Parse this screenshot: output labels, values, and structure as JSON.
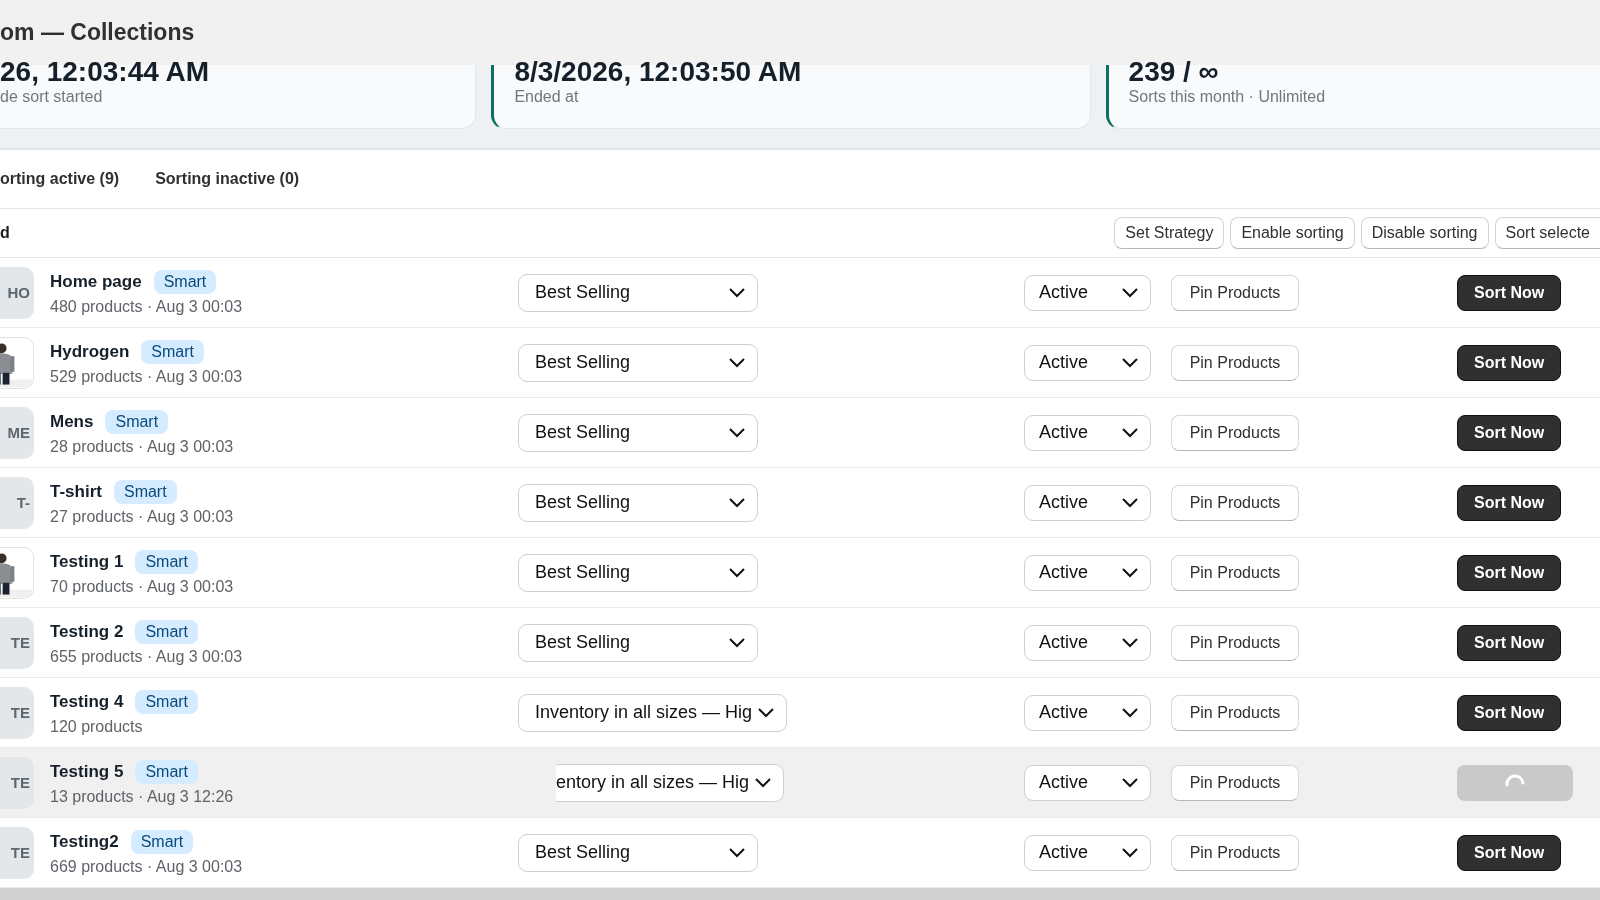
{
  "header": {
    "title": "om — Collections"
  },
  "stats": [
    {
      "value": "26, 12:03:44 AM",
      "label": "de sort started",
      "accent": false
    },
    {
      "value": "8/3/2026, 12:03:50 AM",
      "label": "Ended at",
      "accent": true
    },
    {
      "value": "239 / ∞",
      "label": "Sorts this month · Unlimited",
      "accent": true
    }
  ],
  "tabs": [
    {
      "label": "orting active (9)"
    },
    {
      "label": "Sorting inactive (0)"
    }
  ],
  "toolbar": {
    "label": "d",
    "buttons": [
      "Set Strategy",
      "Enable sorting",
      "Disable sorting",
      "Sort selecte"
    ]
  },
  "rows": [
    {
      "thumb": {
        "kind": "initials",
        "text": "HO"
      },
      "name": "Home page",
      "tag": "Smart",
      "meta": "480 products · Aug 3 00:03",
      "strategy": "Best Selling",
      "status": "Active",
      "pin": "Pin Products",
      "sort": {
        "kind": "button",
        "label": "Sort Now"
      }
    },
    {
      "name": "Hydrogen",
      "tag": "Smart",
      "meta": "529 products · Aug 3 00:03",
      "strategy": "Best Selling",
      "status": "Active",
      "pin": "Pin Products",
      "sort": {
        "kind": "button",
        "label": "Sort Now"
      }
    },
    {
      "thumb": {
        "kind": "initials",
        "text": "ME"
      },
      "name": "Mens",
      "tag": "Smart",
      "meta": "28 products · Aug 3 00:03",
      "strategy": "Best Selling",
      "status": "Active",
      "pin": "Pin Products",
      "sort": {
        "kind": "button",
        "label": "Sort Now"
      }
    },
    {
      "thumb": {
        "kind": "initials",
        "text": "T-"
      },
      "name": "T-shirt",
      "tag": "Smart",
      "meta": "27 products · Aug 3 00:03",
      "strategy": "Best Selling",
      "status": "Active",
      "pin": "Pin Products",
      "sort": {
        "kind": "button",
        "label": "Sort Now"
      }
    },
    {
      "name": "Testing 1",
      "tag": "Smart",
      "meta": "70 products · Aug 3 00:03",
      "strategy": "Best Selling",
      "status": "Active",
      "pin": "Pin Products",
      "sort": {
        "kind": "button",
        "label": "Sort Now"
      }
    },
    {
      "thumb": {
        "kind": "initials",
        "text": "TE"
      },
      "name": "Testing 2",
      "tag": "Smart",
      "meta": "655 products · Aug 3 00:03",
      "strategy": "Best Selling",
      "status": "Active",
      "pin": "Pin Products",
      "sort": {
        "kind": "button",
        "label": "Sort Now"
      }
    },
    {
      "thumb": {
        "kind": "initials",
        "text": "TE"
      },
      "name": "Testing 4",
      "tag": "Smart",
      "meta": "120 products",
      "strategy": "Inventory in all sizes — Hig",
      "status": "Active",
      "pin": "Pin Products",
      "sort": {
        "kind": "button",
        "label": "Sort Now"
      }
    },
    {
      "thumb": {
        "kind": "initials",
        "text": "TE"
      },
      "name": "Testing 5",
      "tag": "Smart",
      "meta": "13 products · Aug 3 12:26",
      "strategy": "entory in all sizes — Hig",
      "status": "Active",
      "pin": "Pin Products",
      "sort": {
        "kind": "loading"
      }
    },
    {
      "thumb": {
        "kind": "initials",
        "text": "TE"
      },
      "name": "Testing2",
      "tag": "Smart",
      "meta": "669 products · Aug 3 00:03",
      "strategy": "Best Selling",
      "status": "Active",
      "pin": "Pin Products",
      "sort": {
        "kind": "button",
        "label": "Sort Now"
      }
    }
  ]
}
